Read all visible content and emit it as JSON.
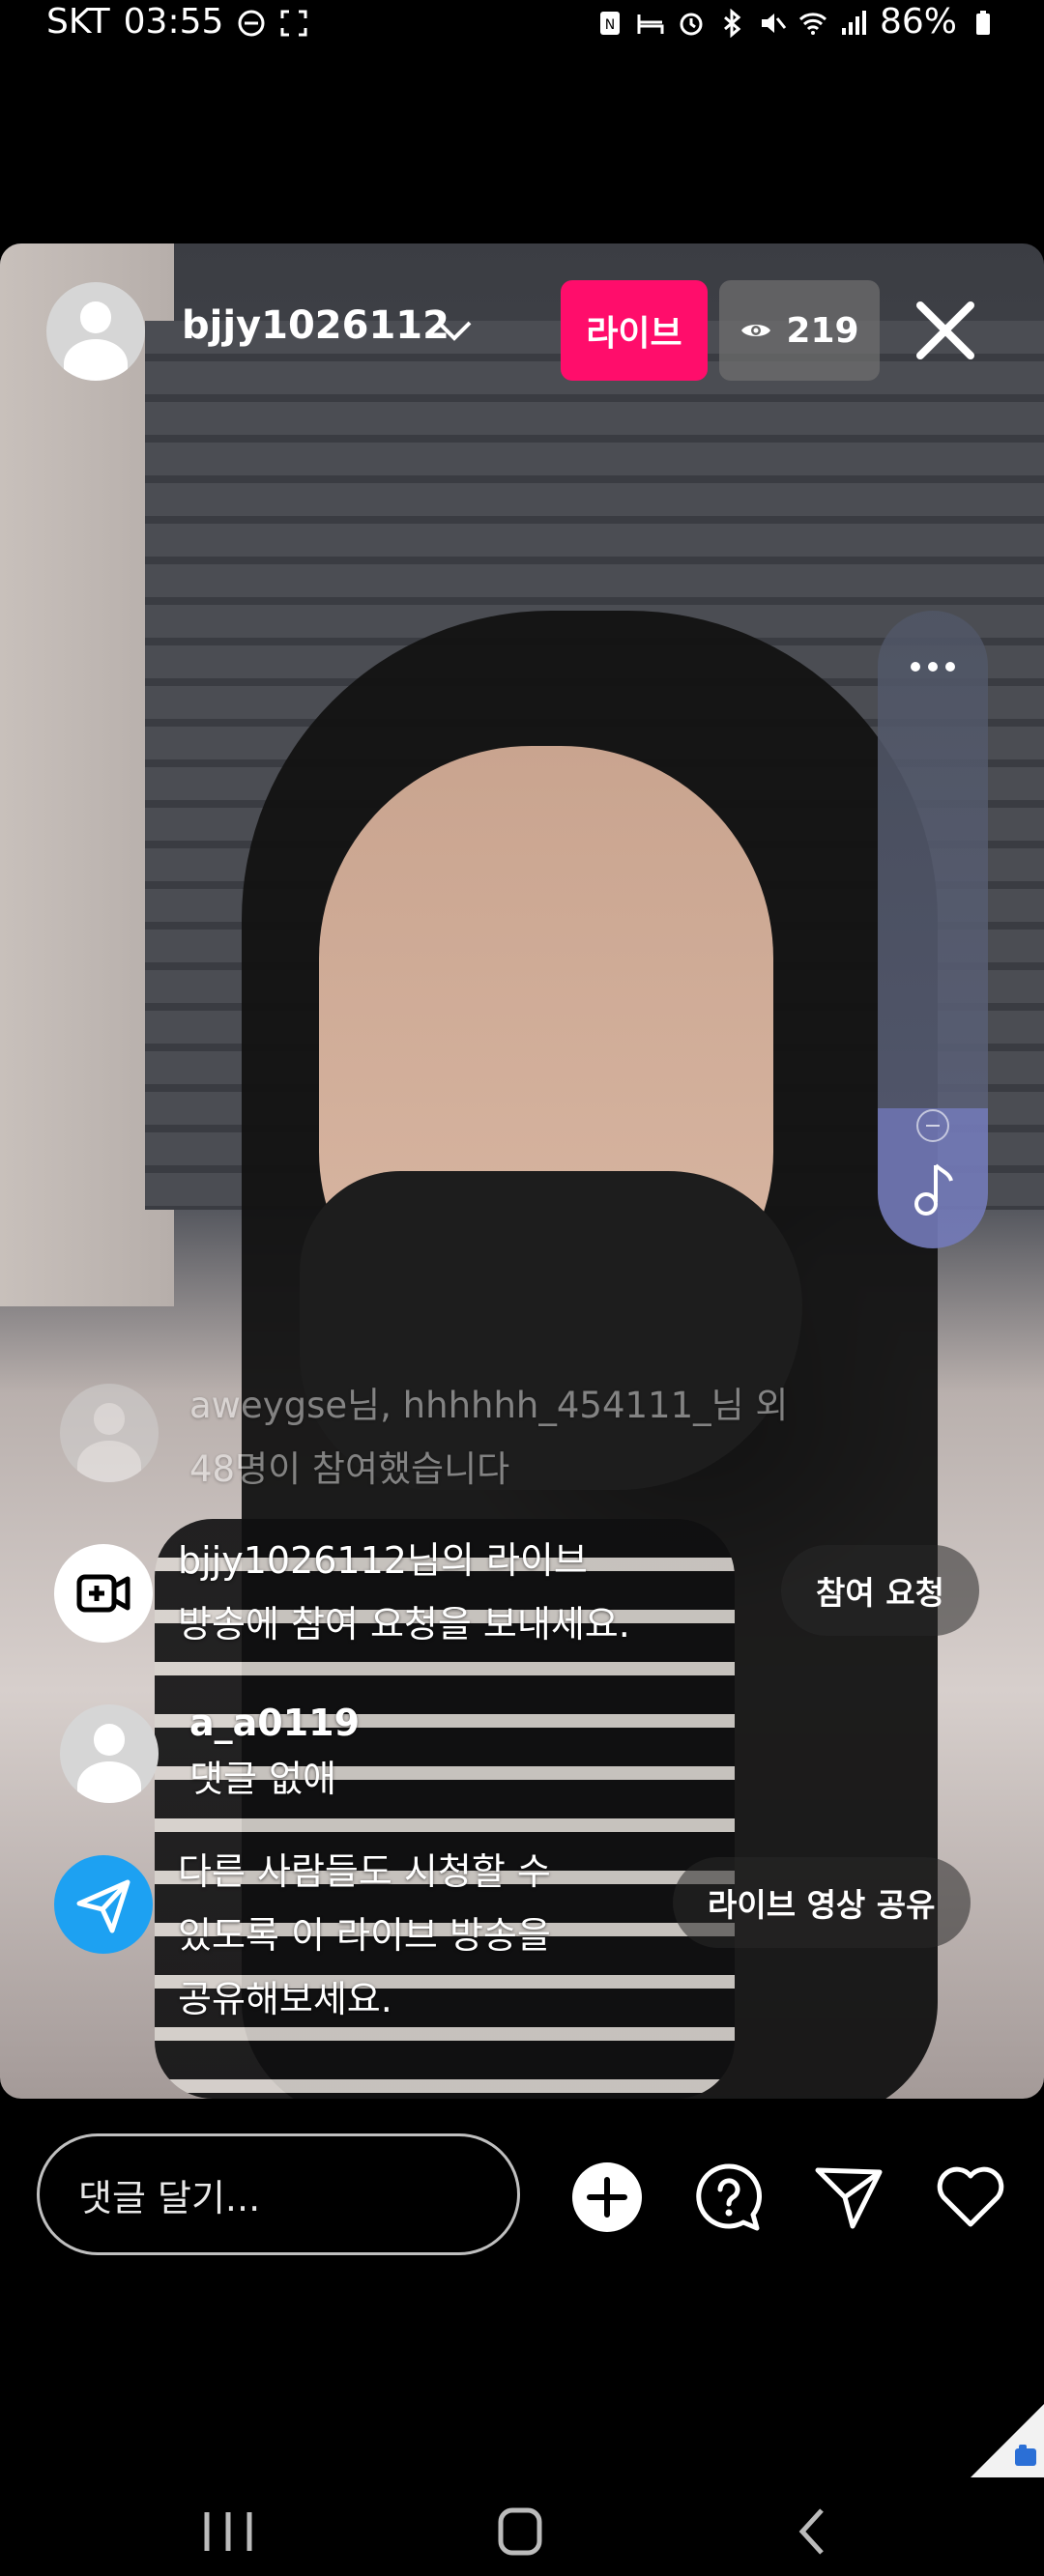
{
  "status_bar": {
    "carrier": "SKT",
    "time": "03:55",
    "battery": "86%",
    "icons": [
      "minus-circle-icon",
      "screen-capture-icon",
      "nfc-icon",
      "bed-icon",
      "alarm-icon",
      "bluetooth-icon",
      "mute-icon",
      "wifi-icon",
      "signal-icon",
      "battery-icon"
    ]
  },
  "live": {
    "username": "bjjy1026112",
    "live_label": "라이브",
    "viewer_count": "219",
    "accent_color": "#ff0d6b"
  },
  "comments": [
    {
      "text_line1": "aweygse님, hhhhhh_454111_님 외",
      "text_line2": "48명이 참여했습니다",
      "faded": true
    },
    {
      "text_line1": "bjjy1026112님의 라이브",
      "text_line2": "방송에 참여 요청을 보내세요.",
      "action": "참여 요청",
      "icon": "video-camera-plus-icon"
    },
    {
      "username": "a_a0119",
      "text": "댓글 없애"
    },
    {
      "text_line1": "다른 사람들도 시청할 수",
      "text_line2": "있도록 이 라이브 방송을",
      "text_line3": "공유해보세요.",
      "action": "라이브 영상 공유",
      "icon": "send-icon",
      "icon_color": "#1da1f2"
    }
  ],
  "bottom_bar": {
    "comment_placeholder": "댓글 달기..."
  }
}
